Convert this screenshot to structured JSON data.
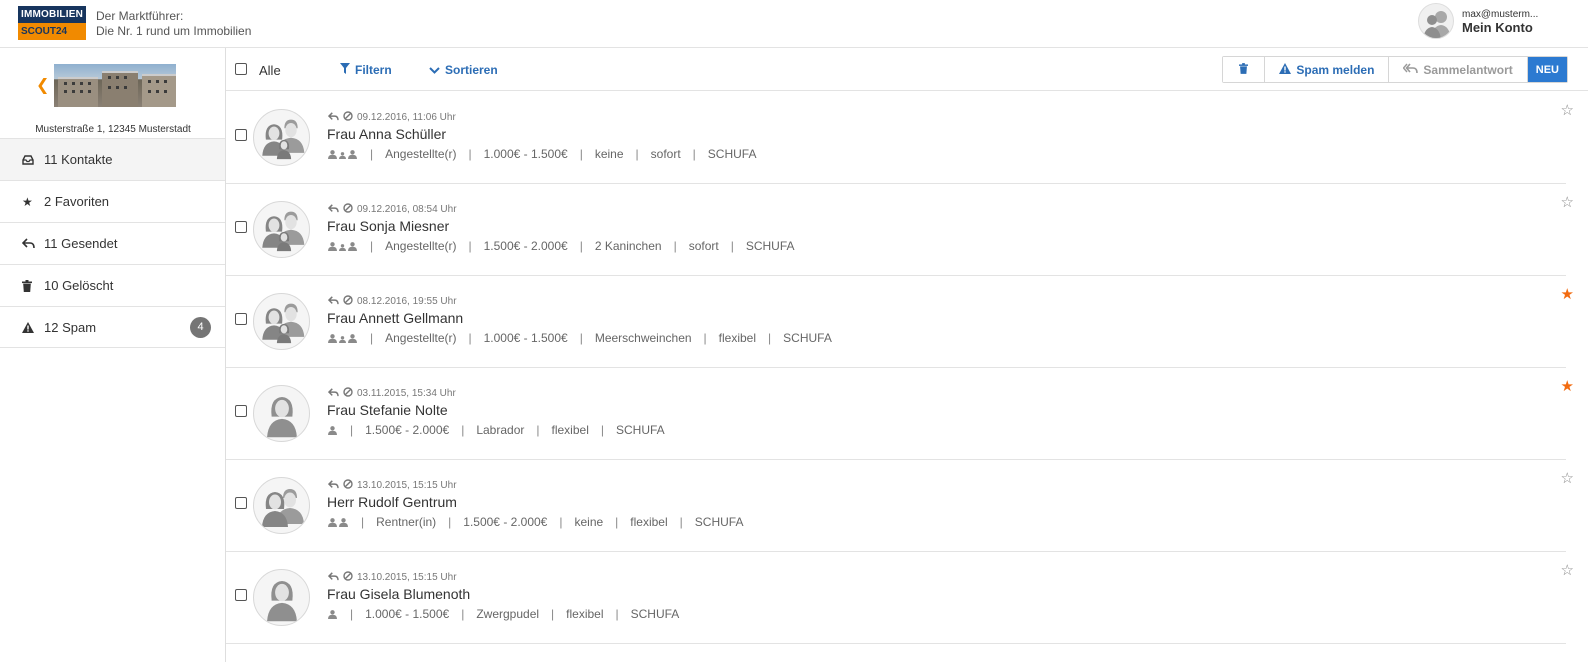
{
  "header": {
    "logo_top": "IMMOBILIEN",
    "logo_bottom": "SCOUT24",
    "tagline_1": "Der Marktführer:",
    "tagline_2": "Die Nr. 1 rund um Immobilien",
    "account_email": "max@musterm...",
    "account_label": "Mein Konto"
  },
  "sidebar": {
    "address": "Musterstraße 1, 12345 Musterstadt",
    "items": [
      {
        "label": "11 Kontakte",
        "icon": "inbox-icon"
      },
      {
        "label": "2 Favoriten",
        "icon": "star-icon"
      },
      {
        "label": "11 Gesendet",
        "icon": "reply-icon"
      },
      {
        "label": "10 Gelöscht",
        "icon": "trash-icon"
      },
      {
        "label": "12 Spam",
        "icon": "warning-icon",
        "badge": "4"
      }
    ]
  },
  "toolbar": {
    "select_all_label": "Alle",
    "filter_label": "Filtern",
    "sort_label": "Sortieren",
    "spam_label": "Spam melden",
    "bulk_reply_label": "Sammelantwort",
    "new_label": "NEU"
  },
  "colors": {
    "brand_blue": "#17355e",
    "brand_orange": "#f18a00",
    "link_blue": "#2c6db5",
    "favorite_orange": "#f26b10"
  },
  "contacts": [
    {
      "date": "09.12.2016, 11:06 Uhr",
      "name": "Frau Anna Schüller",
      "details": [
        "Angestellte(r)",
        "1.000€ - 1.500€",
        "keine",
        "sofort",
        "SCHUFA"
      ],
      "favorite": false
    },
    {
      "date": "09.12.2016, 08:54 Uhr",
      "name": "Frau Sonja Miesner",
      "details": [
        "Angestellte(r)",
        "1.500€ - 2.000€",
        "2 Kaninchen",
        "sofort",
        "SCHUFA"
      ],
      "favorite": false
    },
    {
      "date": "08.12.2016, 19:55 Uhr",
      "name": "Frau Annett Gellmann",
      "details": [
        "Angestellte(r)",
        "1.000€ - 1.500€",
        "Meerschweinchen",
        "flexibel",
        "SCHUFA"
      ],
      "favorite": true
    },
    {
      "date": "03.11.2015, 15:34 Uhr",
      "name": "Frau Stefanie Nolte",
      "details": [
        "1.500€ - 2.000€",
        "Labrador",
        "flexibel",
        "SCHUFA"
      ],
      "favorite": true
    },
    {
      "date": "13.10.2015, 15:15 Uhr",
      "name": "Herr Rudolf Gentrum",
      "details": [
        "Rentner(in)",
        "1.500€ - 2.000€",
        "keine",
        "flexibel",
        "SCHUFA"
      ],
      "favorite": false
    },
    {
      "date": "13.10.2015, 15:15 Uhr",
      "name": "Frau Gisela Blumenoth",
      "details": [
        "1.000€ - 1.500€",
        "Zwergpudel",
        "flexibel",
        "SCHUFA"
      ],
      "favorite": false
    }
  ]
}
